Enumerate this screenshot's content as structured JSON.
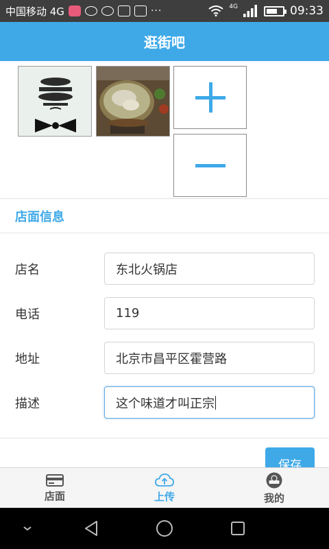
{
  "status_bar": {
    "carrier": "中国移动 4G",
    "more": "···",
    "net_small": "4G",
    "time": "09:33",
    "battery_level": 0.7
  },
  "header": {
    "title": "逛街吧"
  },
  "photos": [
    {
      "name": "fathers-day-card",
      "alt_icon": "bow-tie-image"
    },
    {
      "name": "hotpot-photo",
      "alt_icon": "food-image"
    }
  ],
  "photo_actions": {
    "add_icon": "plus-icon",
    "remove_icon": "minus-icon"
  },
  "store_info": {
    "heading": "店面信息",
    "fields": [
      {
        "label": "店名",
        "value": "东北火锅店"
      },
      {
        "label": "电话",
        "value": "119"
      },
      {
        "label": "地址",
        "value": "北京市昌平区霍营路"
      },
      {
        "label": "描述",
        "value": "这个味道才叫正宗"
      }
    ],
    "save_label": "保存"
  },
  "tabs": [
    {
      "label": "店面",
      "icon": "card-icon",
      "active": false
    },
    {
      "label": "上传",
      "icon": "cloud-upload-icon",
      "active": true
    },
    {
      "label": "我的",
      "icon": "user-icon",
      "active": false
    }
  ],
  "colors": {
    "accent": "#3fa9e8",
    "status_bar": "#3e3e3e",
    "nav_bar": "#000000"
  }
}
